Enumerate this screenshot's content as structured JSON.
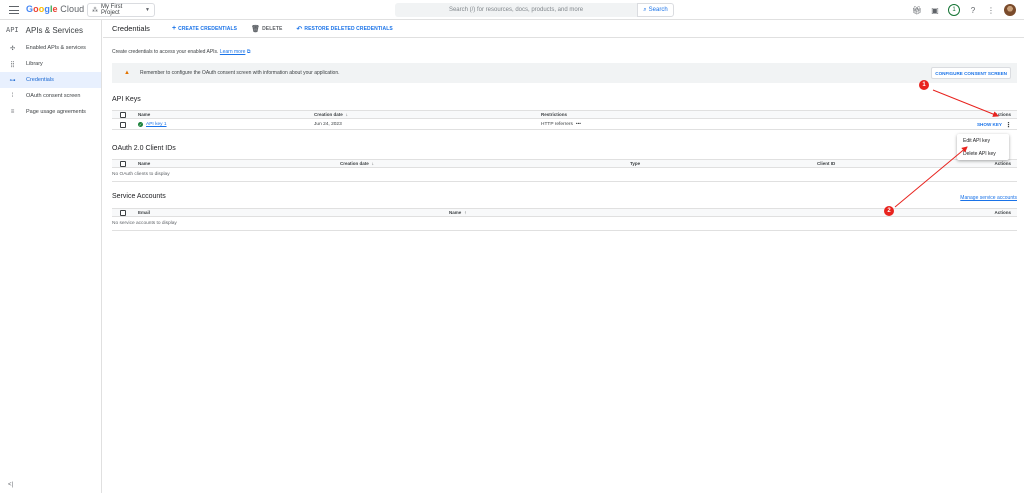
{
  "header": {
    "brand_g1": "G",
    "brand_g2": "o",
    "brand_g3": "o",
    "brand_g4": "g",
    "brand_g5": "l",
    "brand_g6": "e",
    "brand_cloud": "Cloud",
    "project": "My First Project",
    "search_placeholder": "Search (/) for resources, docs, products, and more",
    "search_button": "Search",
    "notification_count": "1"
  },
  "sidebar": {
    "title_icon": "API",
    "title": "APIs & Services",
    "items": [
      {
        "label": "Enabled APIs & services",
        "icon": "hub-icon"
      },
      {
        "label": "Library",
        "icon": "library-icon"
      },
      {
        "label": "Credentials",
        "icon": "key-icon",
        "active": true
      },
      {
        "label": "OAuth consent screen",
        "icon": "consent-icon"
      },
      {
        "label": "Page usage agreements",
        "icon": "agreements-icon"
      }
    ]
  },
  "toolbar": {
    "title": "Credentials",
    "create": "CREATE CREDENTIALS",
    "delete": "DELETE",
    "restore": "RESTORE DELETED CREDENTIALS"
  },
  "intro": {
    "text": "Create credentials to access your enabled APIs.",
    "link": "Learn more"
  },
  "banner": {
    "text": "Remember to configure the OAuth consent screen with information about your application.",
    "button": "CONFIGURE CONSENT SCREEN"
  },
  "api_keys": {
    "title": "API Keys",
    "columns": {
      "name": "Name",
      "creation_date": "Creation date",
      "restrictions": "Restrictions",
      "actions": "Actions"
    },
    "rows": [
      {
        "name": "API key 1",
        "creation_date": "Jun 24, 2023",
        "restrictions": "HTTP referrers",
        "more": "•••",
        "show_key": "SHOW KEY"
      }
    ]
  },
  "menu": {
    "items": [
      "Edit API key",
      "Delete API key"
    ]
  },
  "oauth": {
    "title": "OAuth 2.0 Client IDs",
    "columns": {
      "name": "Name",
      "creation_date": "Creation date",
      "type": "Type",
      "client_id": "Client ID",
      "actions": "Actions"
    },
    "empty": "No OAuth clients to display"
  },
  "service_accounts": {
    "title": "Service Accounts",
    "manage": "Manage service accounts",
    "columns": {
      "email": "Email",
      "name": "Name",
      "actions": "Actions"
    },
    "empty": "No service accounts to display"
  },
  "annotations": {
    "marker1": "1",
    "marker2": "2",
    "color": "#e8231e"
  },
  "colors": {
    "accent": "#1a73e8",
    "active_bg": "#e8f0fe",
    "warning": "#e37400",
    "success": "#188038"
  }
}
